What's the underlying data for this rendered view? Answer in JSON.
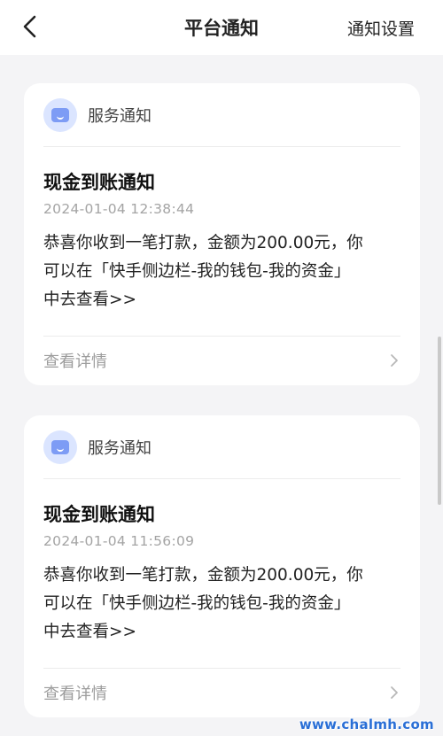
{
  "header": {
    "title": "平台通知",
    "right_action": "通知设置"
  },
  "notifications": [
    {
      "source": "服务通知",
      "title": "现金到账通知",
      "time": "2024-01-04 12:38:44",
      "body_lines": [
        "恭喜你收到一笔打款，金额为200.00元，你",
        "可以在「快手侧边栏-我的钱包-我的资金」",
        "中去查看>>"
      ],
      "footer": "查看详情"
    },
    {
      "source": "服务通知",
      "title": "现金到账通知",
      "time": "2024-01-04 11:56:09",
      "body_lines": [
        "恭喜你收到一笔打款，金额为200.00元，你",
        "可以在「快手侧边栏-我的钱包-我的资金」",
        "中去查看>>"
      ],
      "footer": "查看详情"
    }
  ],
  "watermark": "www.chalmh.com",
  "colors": {
    "background": "#f4f4f6",
    "card": "#ffffff",
    "icon_bg": "#dbe5ff",
    "icon_fg": "#7d9cf5",
    "muted_text": "#a4a4a4",
    "watermark": "#2a6fd6"
  }
}
